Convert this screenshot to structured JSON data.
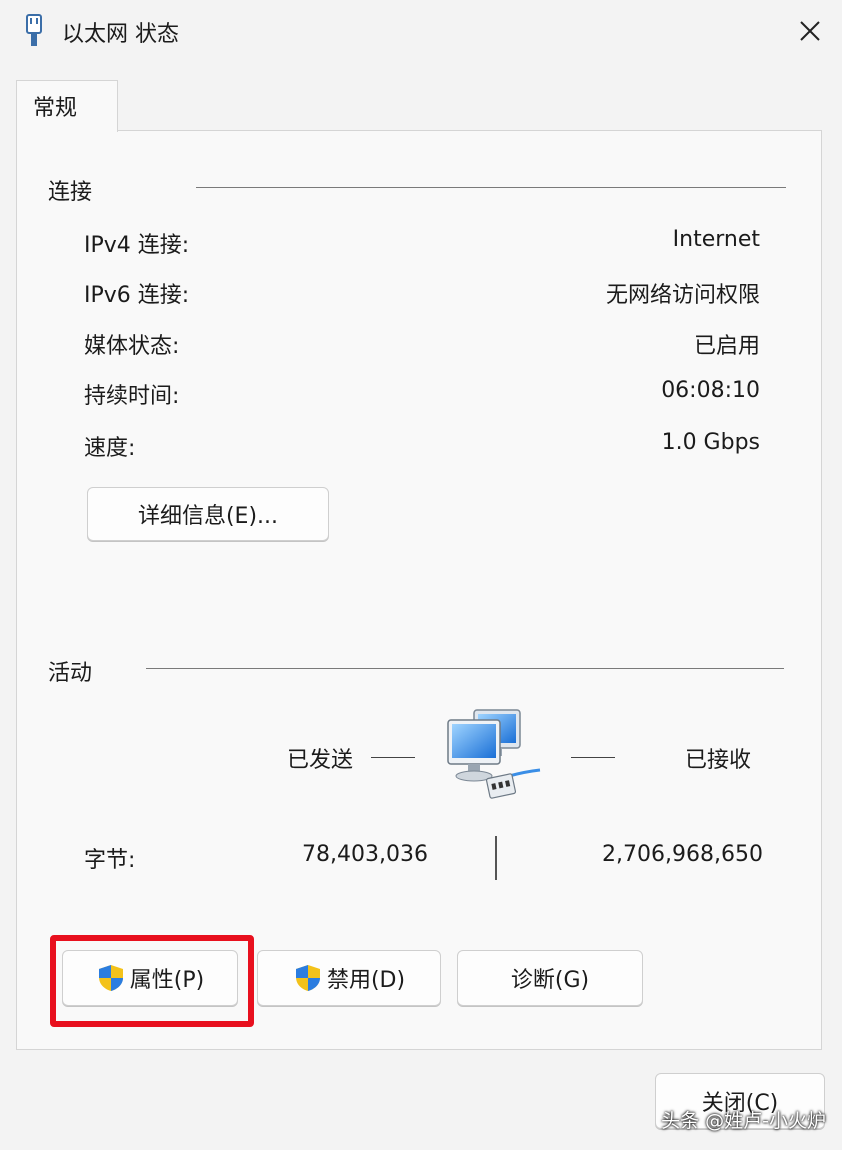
{
  "window": {
    "title": "以太网 状态",
    "close_symbol": "✕"
  },
  "tabs": [
    {
      "label": "常规"
    }
  ],
  "connection": {
    "section_title": "连接",
    "rows": [
      {
        "label": "IPv4 连接:",
        "value": "Internet"
      },
      {
        "label": "IPv6 连接:",
        "value": "无网络访问权限"
      },
      {
        "label": "媒体状态:",
        "value": "已启用"
      },
      {
        "label": "持续时间:",
        "value": "06:08:10"
      },
      {
        "label": "速度:",
        "value": "1.0 Gbps"
      }
    ],
    "details_button": "详细信息(E)..."
  },
  "activity": {
    "section_title": "活动",
    "sent_label": "已发送",
    "received_label": "已接收",
    "bytes_label": "字节:",
    "bytes_sent": "78,403,036",
    "bytes_received": "2,706,968,650"
  },
  "buttons": {
    "properties": "属性(P)",
    "disable": "禁用(D)",
    "diagnose": "诊断(G)",
    "close": "关闭(C)"
  },
  "icons": {
    "title": "ethernet-adapter-icon",
    "network": "network-computers-icon",
    "shield": "uac-shield-icon"
  },
  "colors": {
    "highlight": "#e8101e"
  },
  "watermark": "头条 @姓卢-小火炉"
}
